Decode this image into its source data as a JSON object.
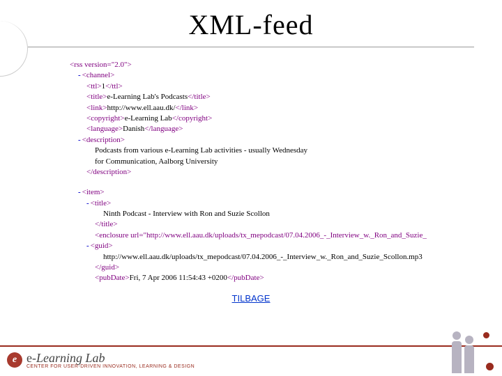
{
  "title": "XML-feed",
  "back_link": "TILBAGE",
  "footer": {
    "badge": "e",
    "logo_a": "e",
    "logo_b": "-Learning Lab",
    "subtitle": "CENTER FOR USER-DRIVEN INNOVATION, LEARNING & DESIGN"
  },
  "xml": {
    "l1": "<rss version=\"2.0\">",
    "l2": "<channel>",
    "l3a": "<ttl>",
    "l3b": "1",
    "l3c": "</ttl>",
    "l4a": "<title>",
    "l4b": "e-Learning Lab's Podcasts",
    "l4c": "</title>",
    "l5a": "<link>",
    "l5b": "http://www.ell.aau.dk/",
    "l5c": "</link>",
    "l6a": "<copyright>",
    "l6b": "e-Learning Lab",
    "l6c": "</copyright>",
    "l7a": "<language>",
    "l7b": "Danish",
    "l7c": "</language>",
    "l8": "<description>",
    "l9": "Podcasts from various e-Learning Lab activities - usually Wednesday",
    "l10": "for Communication, Aalborg University",
    "l11": "</description>",
    "l12": "<item>",
    "l13": "<title>",
    "l14": "Ninth Podcast - Interview with Ron and Suzie Scollon",
    "l15": "</title>",
    "l16": "<enclosure url=\"http://www.ell.aau.dk/uploads/tx_mepodcast/07.04.2006_-_Interview_w._Ron_and_Suzie_",
    "l17": "<guid>",
    "l18": "http://www.ell.aau.dk/uploads/tx_mepodcast/07.04.2006_-_Interview_w._Ron_and_Suzie_Scollon.mp3",
    "l19": "</guid>",
    "l20a": "<pubDate>",
    "l20b": "Fri, 7 Apr 2006 11:54:43 +0200",
    "l20c": "</pubDate>"
  }
}
